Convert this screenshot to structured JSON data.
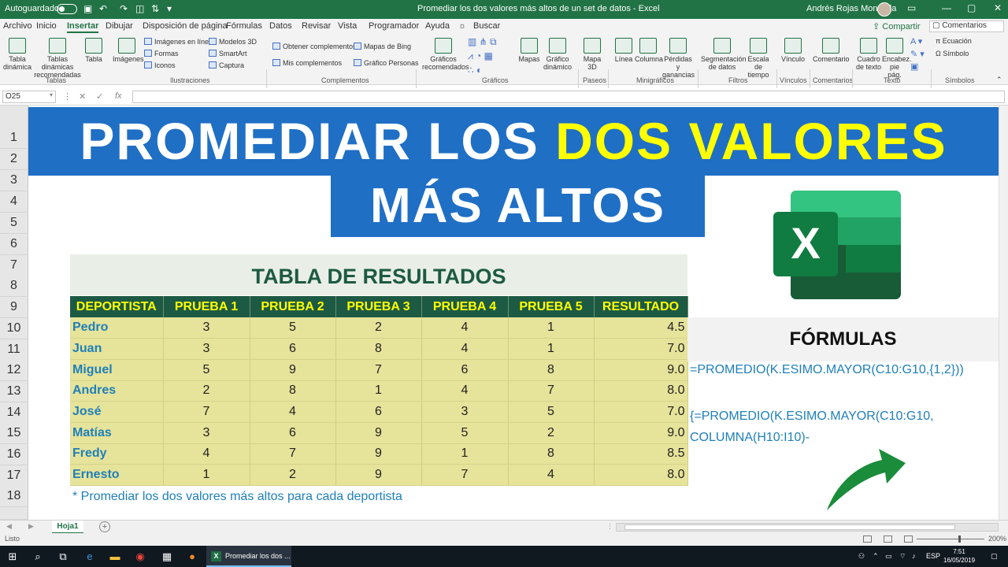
{
  "titlebar": {
    "autosave_label": "Autoguardado",
    "autosave_state": "off",
    "document_title": "Promediar los dos valores más altos de un set de datos - Excel",
    "user_name": "Andrés Rojas Moncada"
  },
  "menu": {
    "tabs": [
      "Archivo",
      "Inicio",
      "Insertar",
      "Dibujar",
      "Disposición de página",
      "Fórmulas",
      "Datos",
      "Revisar",
      "Vista",
      "Programador",
      "Ayuda"
    ],
    "active_tab": "Insertar",
    "search_label": "Buscar",
    "share_label": "Compartir",
    "comments_label": "Comentarios"
  },
  "ribbon": {
    "big_buttons": [
      {
        "label": "Tabla dinámica",
        "icon": "pivot-table-icon"
      },
      {
        "label": "Tablas dinámicas recomendadas",
        "icon": "recommended-pivot-icon"
      },
      {
        "label": "Tabla",
        "icon": "table-icon"
      },
      {
        "label": "Imágenes",
        "icon": "pictures-icon"
      },
      {
        "label": "Gráficos recomendados",
        "icon": "recommended-charts-icon"
      },
      {
        "label": "Mapas",
        "icon": "maps-icon"
      },
      {
        "label": "Gráfico dinámico",
        "icon": "pivot-chart-icon"
      },
      {
        "label": "Mapa 3D",
        "icon": "map-3d-icon"
      },
      {
        "label": "Línea",
        "icon": "line-sparkline-icon"
      },
      {
        "label": "Columna",
        "icon": "column-sparkline-icon"
      },
      {
        "label": "Pérdidas y ganancias",
        "icon": "win-loss-icon"
      },
      {
        "label": "Segmentación de datos",
        "icon": "slicer-icon"
      },
      {
        "label": "Escala de tiempo",
        "icon": "timeline-icon"
      },
      {
        "label": "Vínculo",
        "icon": "link-icon"
      },
      {
        "label": "Comentario",
        "icon": "comment-icon"
      },
      {
        "label": "Cuadro de texto",
        "icon": "textbox-icon"
      },
      {
        "label": "Encabez. pie pág.",
        "icon": "header-footer-icon"
      }
    ],
    "small_buttons": {
      "online_pictures": "Imágenes en línea",
      "shapes": "Formas",
      "icons": "Iconos",
      "models_3d": "Modelos 3D",
      "smartart": "SmartArt",
      "screenshot": "Captura",
      "get_addins": "Obtener complementos",
      "my_addins": "Mis complementos",
      "bing_maps": "Mapas de Bing",
      "people_graph": "Gráfico Personas",
      "equation": "Ecuación",
      "symbol": "Símbolo"
    },
    "groups": [
      "Tablas",
      "Ilustraciones",
      "Complementos",
      "Gráficos",
      "Paseos",
      "Minigráficos",
      "Filtros",
      "Vínculos",
      "Comentarios",
      "Texto",
      "Símbolos"
    ]
  },
  "formula_bar": {
    "name_box": "O25",
    "fx": "fx",
    "formula": ""
  },
  "sheet": {
    "row_numbers": [
      "1",
      "2",
      "3",
      "4",
      "5",
      "6",
      "7",
      "8",
      "9",
      "10",
      "11",
      "12",
      "13",
      "14",
      "15",
      "16",
      "17",
      "18"
    ],
    "banner_line1_a": "PROMEDIAR LOS ",
    "banner_line1_b": "DOS VALORES",
    "banner_line2": "MÁS ALTOS",
    "table_title": "TABLA DE RESULTADOS",
    "headers": [
      "DEPORTISTA",
      "PRUEBA 1",
      "PRUEBA 2",
      "PRUEBA 3",
      "PRUEBA 4",
      "PRUEBA 5",
      "RESULTADO"
    ],
    "rows": [
      [
        "Pedro",
        "3",
        "5",
        "2",
        "4",
        "1",
        "4.5"
      ],
      [
        "Juan",
        "3",
        "6",
        "8",
        "4",
        "1",
        "7.0"
      ],
      [
        "Miguel",
        "5",
        "9",
        "7",
        "6",
        "8",
        "9.0"
      ],
      [
        "Andres",
        "2",
        "8",
        "1",
        "4",
        "7",
        "8.0"
      ],
      [
        "José",
        "7",
        "4",
        "6",
        "3",
        "5",
        "7.0"
      ],
      [
        "Matías",
        "3",
        "6",
        "9",
        "5",
        "2",
        "9.0"
      ],
      [
        "Fredy",
        "4",
        "7",
        "9",
        "1",
        "8",
        "8.5"
      ],
      [
        "Ernesto",
        "1",
        "2",
        "9",
        "7",
        "4",
        "8.0"
      ]
    ],
    "note": "* Promediar los dos valores más altos para cada deportista",
    "formulas_title": "FÓRMULAS",
    "formula1": "=PROMEDIO(K.ESIMO.MAYOR(C10:G10,{1,2}))",
    "formula2": "{=PROMEDIO(K.ESIMO.MAYOR(C10:G10,COLUMNA(H10:I10)-",
    "logo_letter": "X"
  },
  "sheet_tabs": [
    "Hoja1"
  ],
  "status": {
    "ready": "Listo",
    "zoom": "200%"
  },
  "taskbar": {
    "app_label": "Promediar los dos ...",
    "lang": "ESP",
    "time": "7:51",
    "date": "16/05/2019"
  },
  "colors": {
    "excel_green": "#217346",
    "banner_blue": "#1f6fc5",
    "highlight_yellow": "#ffff00",
    "table_header_green": "#1d5a44",
    "table_body_yellow": "#e6e39a",
    "name_blue": "#1f80b8",
    "arrow_green": "#1a8c3a"
  }
}
